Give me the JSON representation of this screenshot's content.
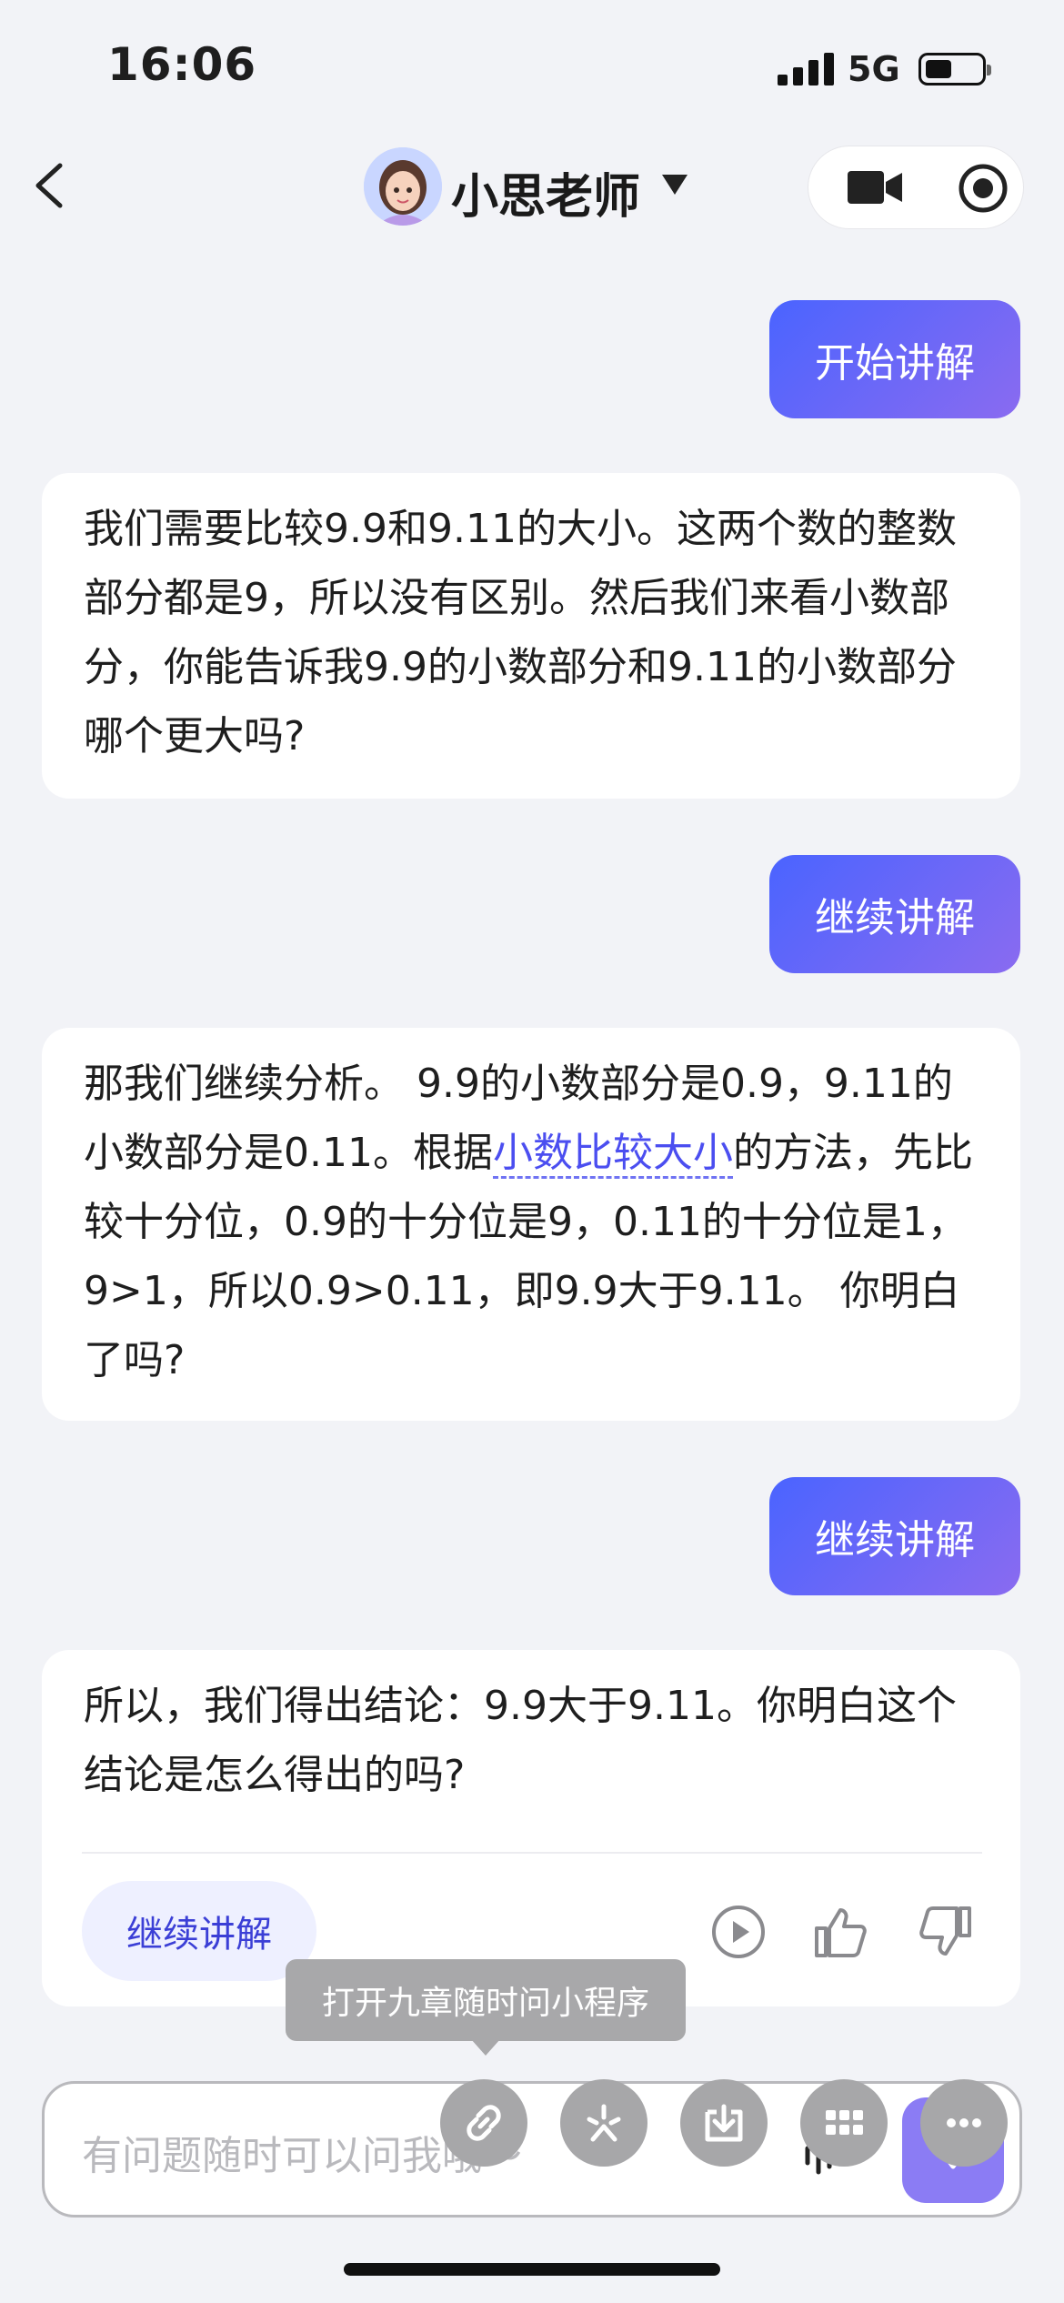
{
  "status_bar": {
    "time": "16:06",
    "network": "5G"
  },
  "header": {
    "title": "小思老师"
  },
  "messages": [
    {
      "role": "user",
      "text": "开始讲解"
    },
    {
      "role": "assistant",
      "text": "我们需要比较9.9和9.11的大小。这两个数的整数部分都是9，所以没有区别。然后我们来看小数部分，你能告诉我9.9的小数部分和9.11的小数部分哪个更大吗?"
    },
    {
      "role": "user",
      "text": "继续讲解"
    },
    {
      "role": "assistant",
      "text_before": "那我们继续分析。 9.9的小数部分是0.9，9.11的小数部分是0.11。根据",
      "link": "小数比较大小",
      "text_after": "的方法，先比较十分位，0.9的十分位是9，0.11的十分位是1，9>1，所以0.9>0.11，即9.9大于9.11。 你明白了吗?"
    },
    {
      "role": "user",
      "text": "继续讲解"
    },
    {
      "role": "assistant",
      "text": "所以，我们得出结论：9.9大于9.11。你明白这个结论是怎么得出的吗?"
    }
  ],
  "suggestion_chip": "继续讲解",
  "tooltip": "打开九章随时问小程序",
  "input": {
    "placeholder": "有问题随时可以问我哦～"
  },
  "colors": {
    "accent": "#4a64ff",
    "accent_end": "#8a6bf0",
    "link": "#4b4ef0"
  }
}
